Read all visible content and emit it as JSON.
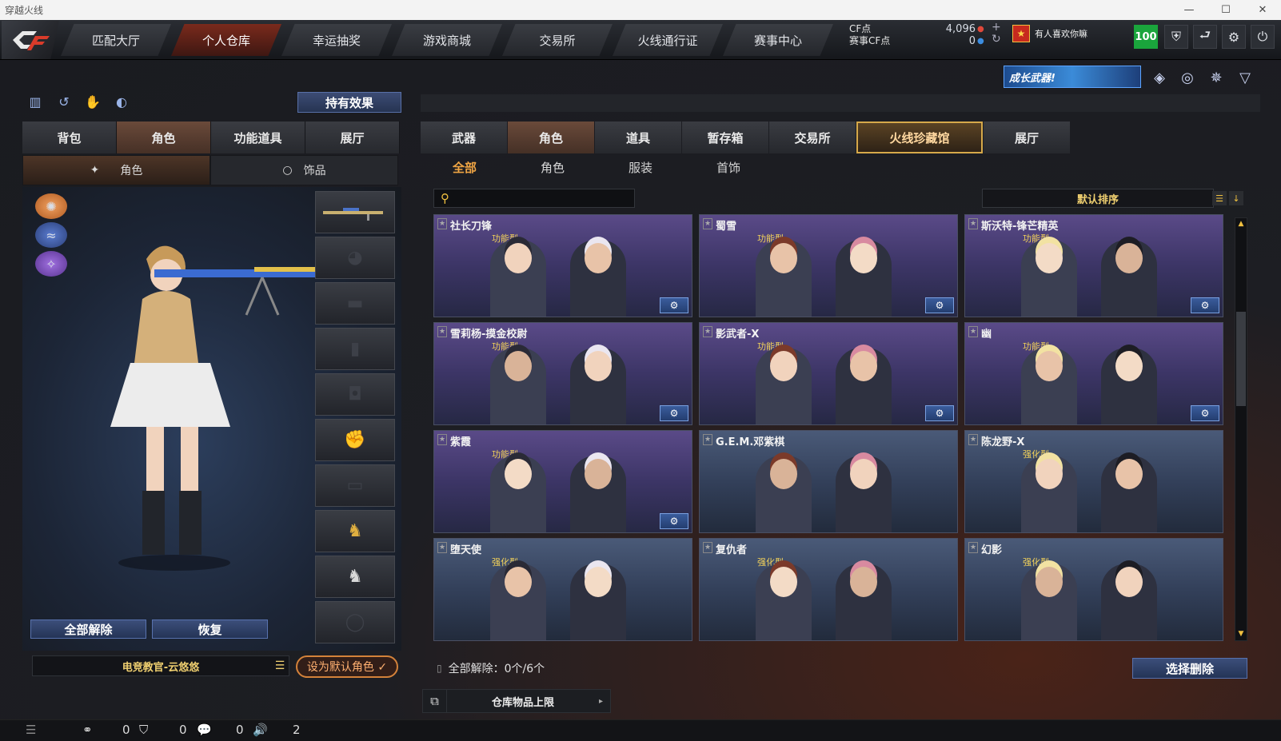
{
  "window": {
    "title": "穿越火线",
    "minimize": "—",
    "maximize": "☐",
    "close": "✕"
  },
  "nav": [
    "匹配大厅",
    "个人仓库",
    "幸运抽奖",
    "游戏商城",
    "交易所",
    "火线通行证",
    "赛事中心"
  ],
  "currency": {
    "cf_label": "CF点",
    "cf_value": "4,096",
    "match_label": "赛事CF点",
    "match_value": "0"
  },
  "notice": "有人喜欢你嘛",
  "level": "100",
  "banner": "成长武器!",
  "effect_button": "持有效果",
  "left_tabs": [
    "背包",
    "角色",
    "功能道具",
    "展厅"
  ],
  "left_subtabs": [
    "角色",
    "饰品"
  ],
  "left_buttons": {
    "clear_all": "全部解除",
    "restore": "恢复"
  },
  "character_name": "电竞教官-云悠悠",
  "set_default": "设为默认角色 ✓",
  "right_tabs": [
    "武器",
    "角色",
    "道具",
    "暂存箱",
    "交易所",
    "火线珍藏馆",
    "展厅"
  ],
  "right_subtabs": [
    "全部",
    "角色",
    "服装",
    "首饰"
  ],
  "search": {
    "placeholder": ""
  },
  "sort_label": "默认排序",
  "cards": [
    {
      "name": "社长刀锋",
      "type": "功能型",
      "kind": "func",
      "gear": true
    },
    {
      "name": "蜀雪",
      "type": "功能型",
      "kind": "func",
      "gear": true
    },
    {
      "name": "斯沃特-锋芒精英",
      "type": "功能型",
      "kind": "func",
      "gear": true
    },
    {
      "name": "雪莉杨-摸金校尉",
      "type": "功能型",
      "kind": "func",
      "gear": true
    },
    {
      "name": "影武者-X",
      "type": "功能型",
      "kind": "func",
      "gear": true
    },
    {
      "name": "幽",
      "type": "功能型",
      "kind": "func",
      "gear": true
    },
    {
      "name": "紫霞",
      "type": "功能型",
      "kind": "func",
      "gear": true
    },
    {
      "name": "G.E.M.邓紫棋",
      "type": "",
      "kind": "str",
      "gear": false
    },
    {
      "name": "陈龙野-X",
      "type": "强化型",
      "kind": "str",
      "gear": false
    },
    {
      "name": "堕天使",
      "type": "强化型",
      "kind": "str",
      "gear": false
    },
    {
      "name": "复仇者",
      "type": "强化型",
      "kind": "str",
      "gear": false
    },
    {
      "name": "幻影",
      "type": "强化型",
      "kind": "str",
      "gear": false
    }
  ],
  "bottom": {
    "clear_all_label": "全部解除：",
    "clear_all_count": "0个/6个",
    "select_delete": "选择删除",
    "storage_limit": "仓库物品上限"
  },
  "status": {
    "v1": "0",
    "v2": "0",
    "v3": "0",
    "v4": "2"
  }
}
